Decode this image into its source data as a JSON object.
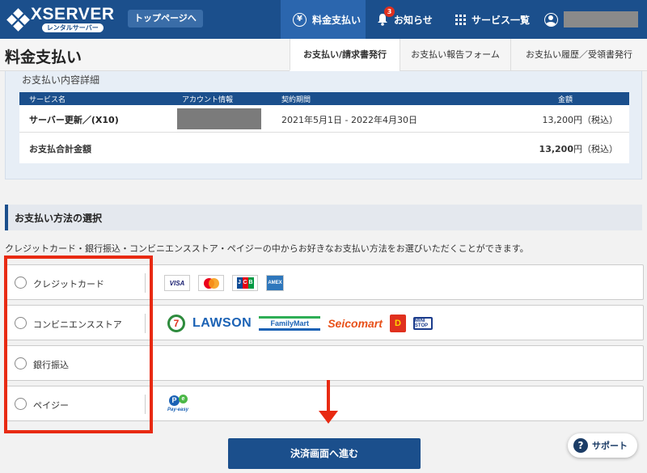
{
  "topnav": {
    "logo": "XSERVER",
    "logo_sub": "レンタルサーバー",
    "top_page_label": "トップページへ",
    "payment_label": "料金支払い",
    "news_label": "お知らせ",
    "news_badge": "3",
    "services_label": "サービス一覧",
    "yen_symbol": "¥"
  },
  "header": {
    "title": "料金支払い",
    "tabs": [
      {
        "label": "お支払い/請求書発行"
      },
      {
        "label": "お支払い報告フォーム"
      },
      {
        "label": "お支払い履歴／受領書発行"
      }
    ]
  },
  "details": {
    "title": "お支払い内容詳細",
    "columns": [
      "サービス名",
      "アカウント情報",
      "契約期間",
      "金額"
    ],
    "row": {
      "service": "サーバー更新／(X10)",
      "period": "2021年5月1日 - 2022年4月30日",
      "amount": "13,200円（税込）"
    },
    "total": {
      "label": "お支払合計金額",
      "amount": "13,200",
      "suffix": "円（税込）"
    }
  },
  "payment": {
    "section_title": "お支払い方法の選択",
    "description": "クレジットカード・銀行振込・コンビニエンスストア・ペイジーの中からお好きなお支払い方法をお選びいただくことができます。",
    "options": [
      {
        "label": "クレジットカード"
      },
      {
        "label": "コンビニエンスストア"
      },
      {
        "label": "銀行振込"
      },
      {
        "label": "ペイジー"
      }
    ],
    "cards": {
      "visa": "VISA",
      "jcb": [
        "J",
        "C",
        "B"
      ],
      "amex": "AMEX"
    },
    "stores": {
      "seven": "7",
      "lawson": "LAWSON",
      "familymart": "FamilyMart",
      "seicomart": "Seicomart",
      "daily": "D",
      "ministop": "MINI STOP"
    },
    "payeasy": {
      "p": "P",
      "e": "e",
      "text": "Pay-easy"
    },
    "submit_label": "決済画面へ進む"
  },
  "support": {
    "label": "サポート",
    "icon": "?"
  },
  "colors": {
    "brand": "#1b4f8c",
    "annotation": "#e82a12"
  }
}
